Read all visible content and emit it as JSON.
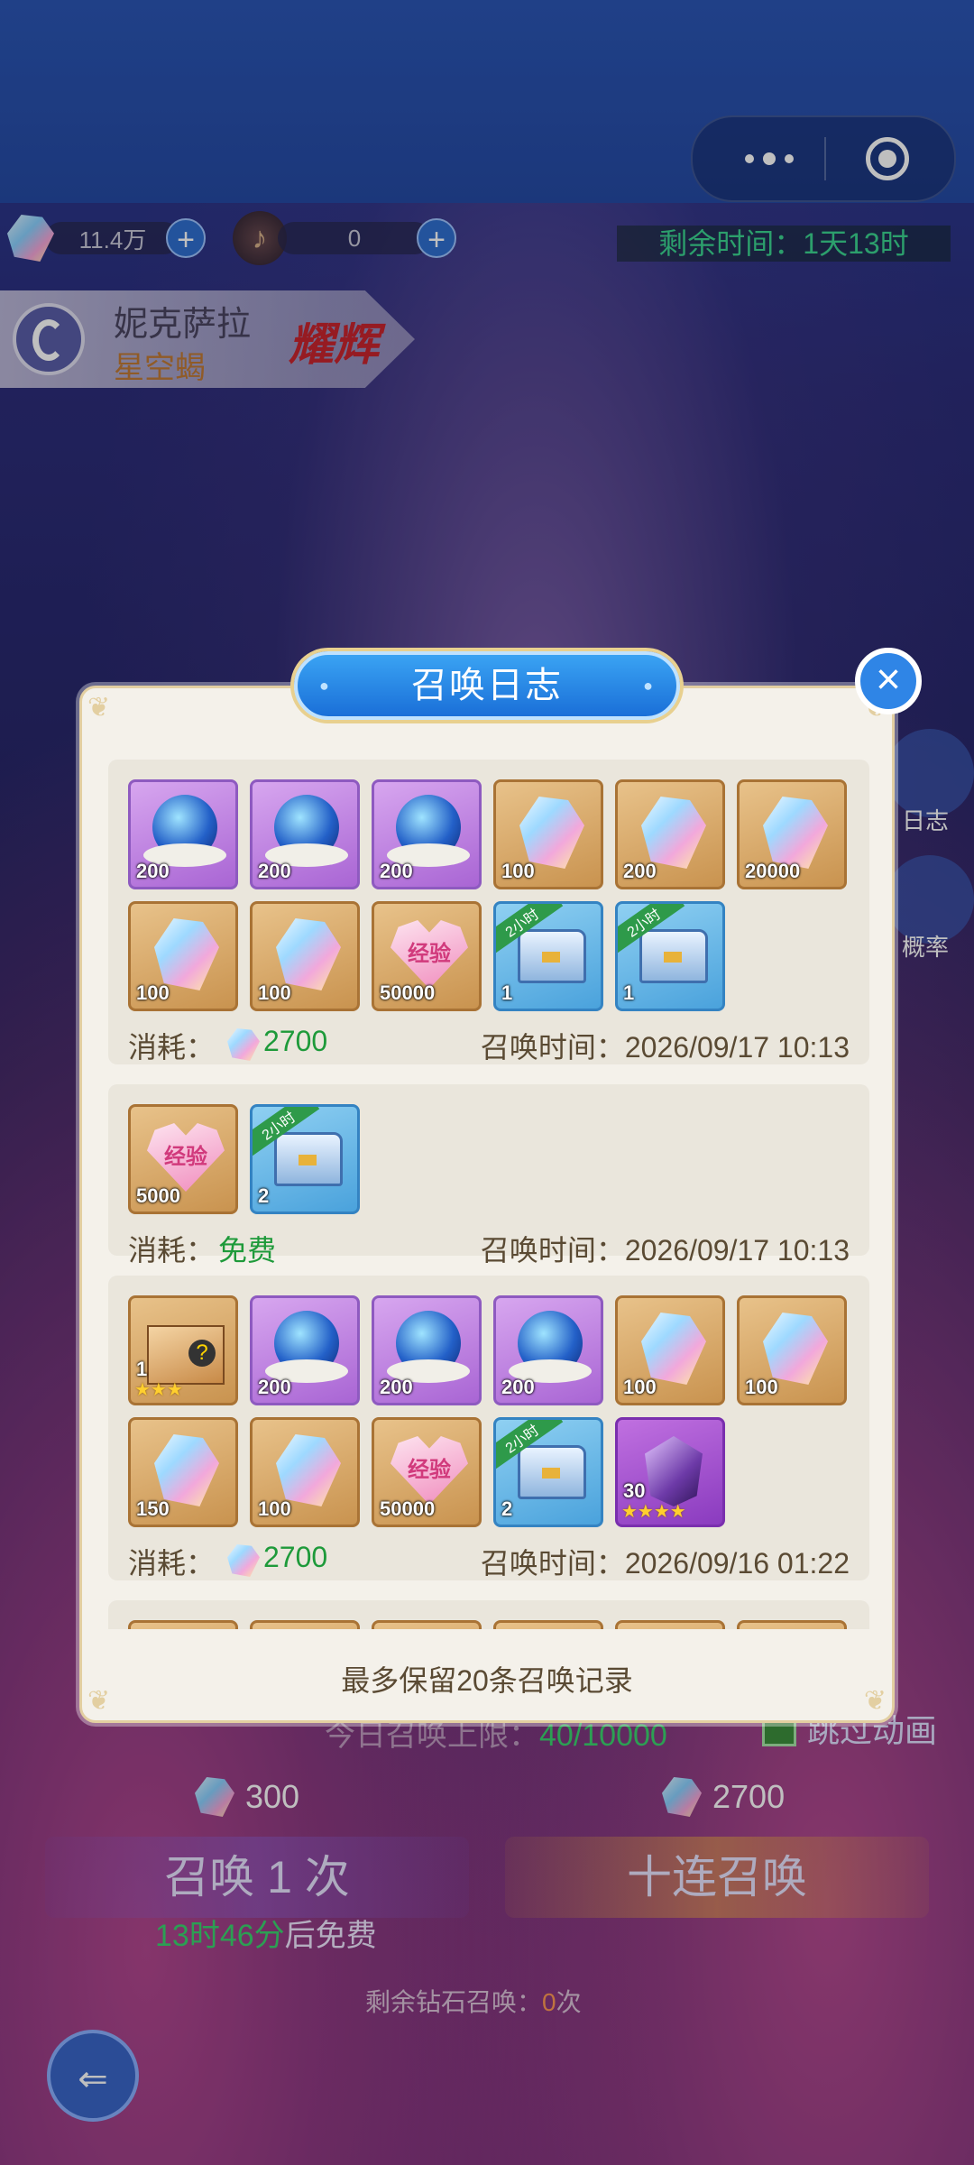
{
  "status_bar": {
    "menu_icon": "more-dots-icon",
    "target_icon": "record-target-icon"
  },
  "resources": {
    "diamond_amount": "11.4万",
    "note_amount": "0"
  },
  "remaining_time": "剩余时间：1天13时",
  "hero": {
    "name": "妮克萨拉",
    "title": "星空蝎",
    "rank": "耀辉"
  },
  "side_buttons": {
    "log_label": "日志",
    "rate_label": "概率"
  },
  "summon_log_dialog": {
    "title": "召唤日志",
    "records": [
      {
        "items": [
          {
            "icon": "star-orb-icon",
            "count": "200"
          },
          {
            "icon": "star-orb-icon",
            "count": "200"
          },
          {
            "icon": "star-orb-icon",
            "count": "200"
          },
          {
            "icon": "diamond-icon",
            "count": "100"
          },
          {
            "icon": "diamond-icon",
            "count": "200"
          },
          {
            "icon": "diamond-icon",
            "count": "20000"
          },
          {
            "icon": "diamond-icon",
            "count": "100"
          },
          {
            "icon": "diamond-icon",
            "count": "100"
          },
          {
            "icon": "exp-heart-icon",
            "count": "50000",
            "label": "经验"
          },
          {
            "icon": "treasure-chest-icon",
            "count": "1",
            "tag": "2小时"
          },
          {
            "icon": "treasure-chest-icon",
            "count": "1",
            "tag": "2小时"
          }
        ],
        "cost_label": "消耗：",
        "cost_value": "2700",
        "time_label": "召唤时间：",
        "time_value": "2026/09/17 10:13"
      },
      {
        "items": [
          {
            "icon": "exp-heart-icon",
            "count": "5000",
            "label": "经验"
          },
          {
            "icon": "treasure-chest-icon",
            "count": "2",
            "tag": "2小时"
          }
        ],
        "cost_label": "消耗：",
        "cost_value": "免费",
        "time_label": "召唤时间：",
        "time_value": "2026/09/17 10:13"
      },
      {
        "items": [
          {
            "icon": "mystery-box-icon",
            "count": "1",
            "stars": "★★★"
          },
          {
            "icon": "star-orb-icon",
            "count": "200"
          },
          {
            "icon": "star-orb-icon",
            "count": "200"
          },
          {
            "icon": "star-orb-icon",
            "count": "200"
          },
          {
            "icon": "diamond-icon",
            "count": "100"
          },
          {
            "icon": "diamond-icon",
            "count": "100"
          },
          {
            "icon": "diamond-icon",
            "count": "150"
          },
          {
            "icon": "diamond-icon",
            "count": "100"
          },
          {
            "icon": "exp-heart-icon",
            "count": "50000",
            "label": "经验"
          },
          {
            "icon": "treasure-chest-icon",
            "count": "2",
            "tag": "2小时"
          },
          {
            "icon": "purple-crystal-icon",
            "count": "30",
            "stars": "★★★★"
          }
        ],
        "cost_label": "消耗：",
        "cost_value": "2700",
        "time_label": "召唤时间：",
        "time_value": "2026/09/16 01:22"
      }
    ],
    "footer_note": "最多保留20条召唤记录"
  },
  "bottom": {
    "daily_limit_label": "今日召唤上限：",
    "daily_limit_value": "40/10000",
    "skip_animation": "跳过动画",
    "single_cost": "300",
    "ten_cost": "2700",
    "single_summon": "召唤 1 次",
    "ten_summon": "十连召唤",
    "free_time": "13时46分",
    "free_suffix": "后免费",
    "diamond_remaining_label": "剩余钻石召唤：",
    "diamond_remaining_value": "0",
    "diamond_remaining_unit": "次"
  },
  "colors": {
    "accent_blue": "#2f85e6",
    "cost_green": "#1e9a3a",
    "dialog_bg": "#f4f1ea",
    "text_brown": "#5a4a33"
  }
}
